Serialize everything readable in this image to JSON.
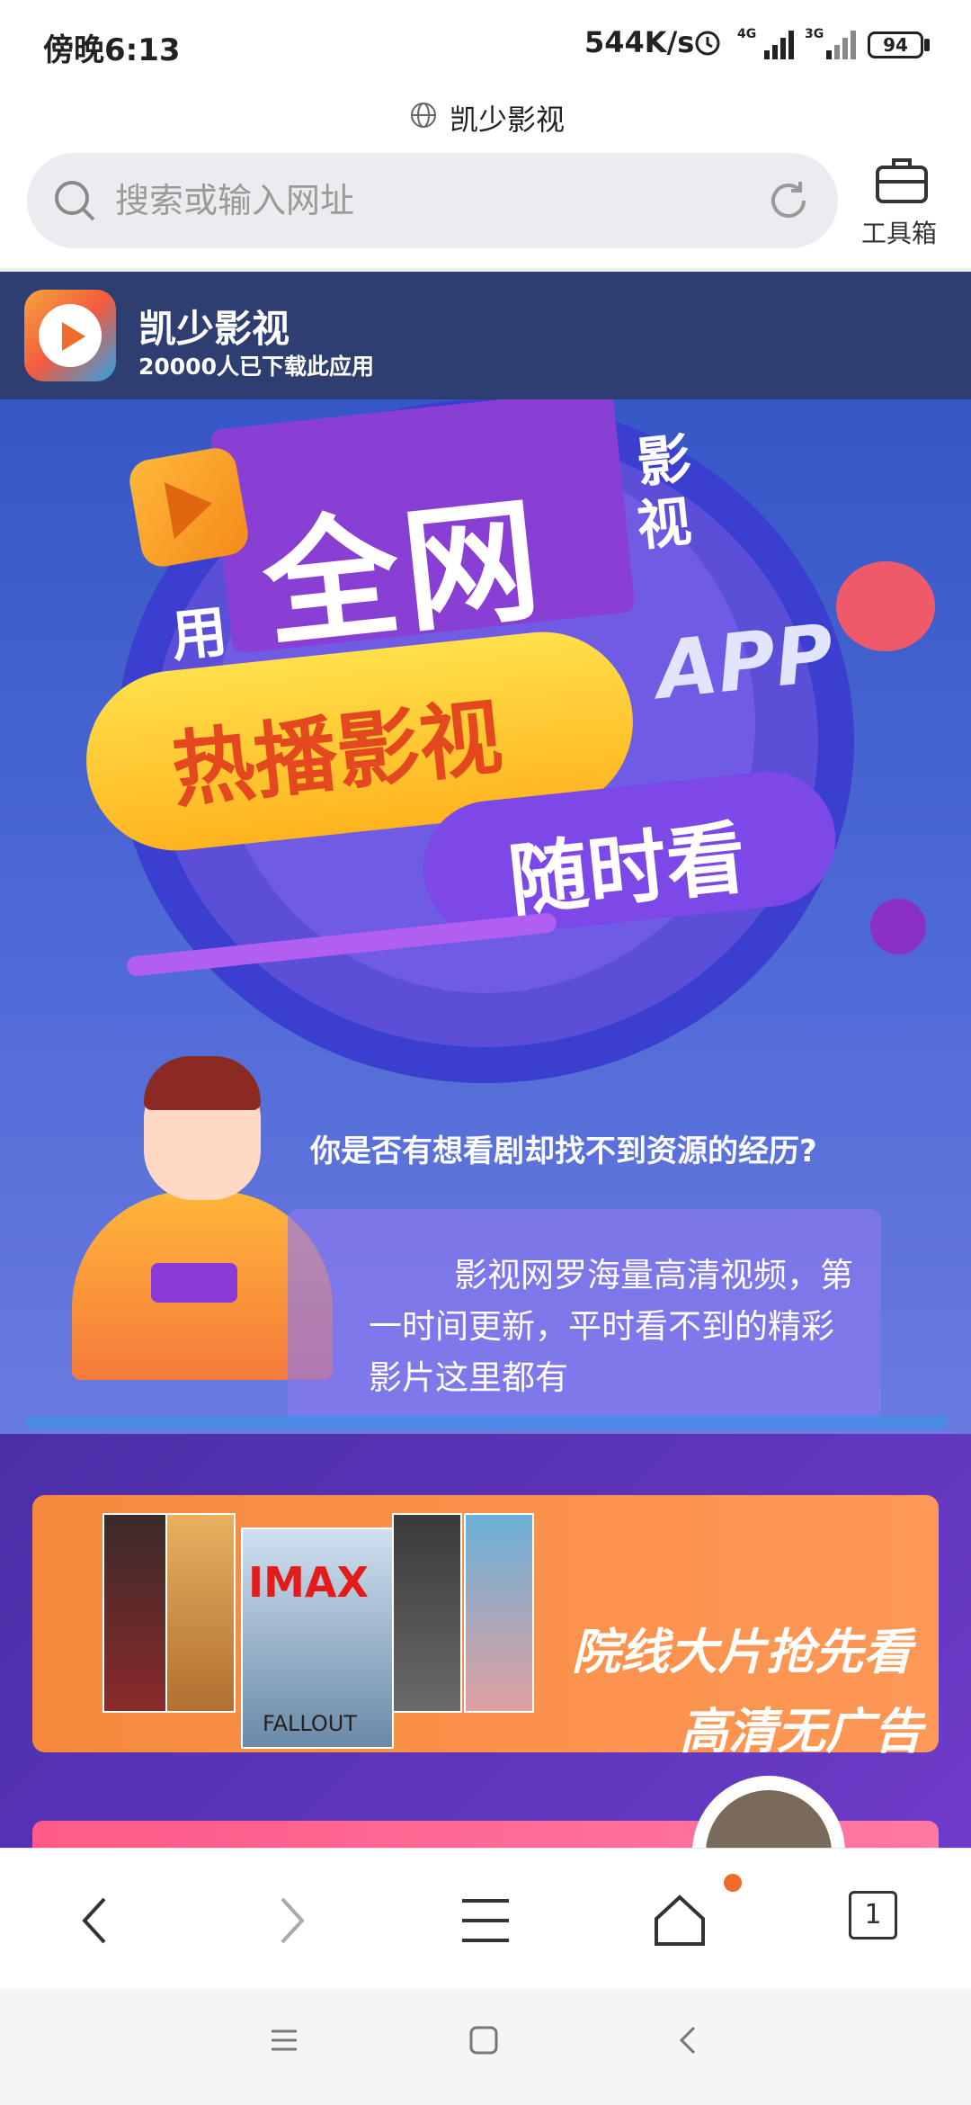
{
  "status": {
    "time": "傍晚6:13",
    "speed": "544K/s",
    "battery": "94",
    "net1": "4G",
    "net2": "3G"
  },
  "site": {
    "title": "凯少影视"
  },
  "search": {
    "placeholder": "搜索或输入网址"
  },
  "toolbox": {
    "label": "工具箱"
  },
  "app": {
    "name": "凯少影视",
    "downloads": "20000人已下载此应用"
  },
  "hero": {
    "headline_big": "全网",
    "headline_side_1": "影",
    "headline_side_2": "视",
    "headline_use": "用",
    "app_word": "APP",
    "hot": "热播影视",
    "anytime": "随时看",
    "question": "你是否有想看剧却找不到资源的经历?",
    "description": "影视网罗海量高清视频，第一时间更新，平时看不到的精彩影片这里都有"
  },
  "banner2": {
    "poster_imax": "IMAX",
    "poster_fallout": "FALLOUT",
    "slogan_1": "院线大片抢先看",
    "slogan_2": "高清无广告"
  },
  "nav": {
    "tab_count": "1"
  },
  "colors": {
    "app_header_bg": "#2f3e70",
    "accent_orange": "#f06a2a",
    "hero_blue": "#3657c6"
  }
}
